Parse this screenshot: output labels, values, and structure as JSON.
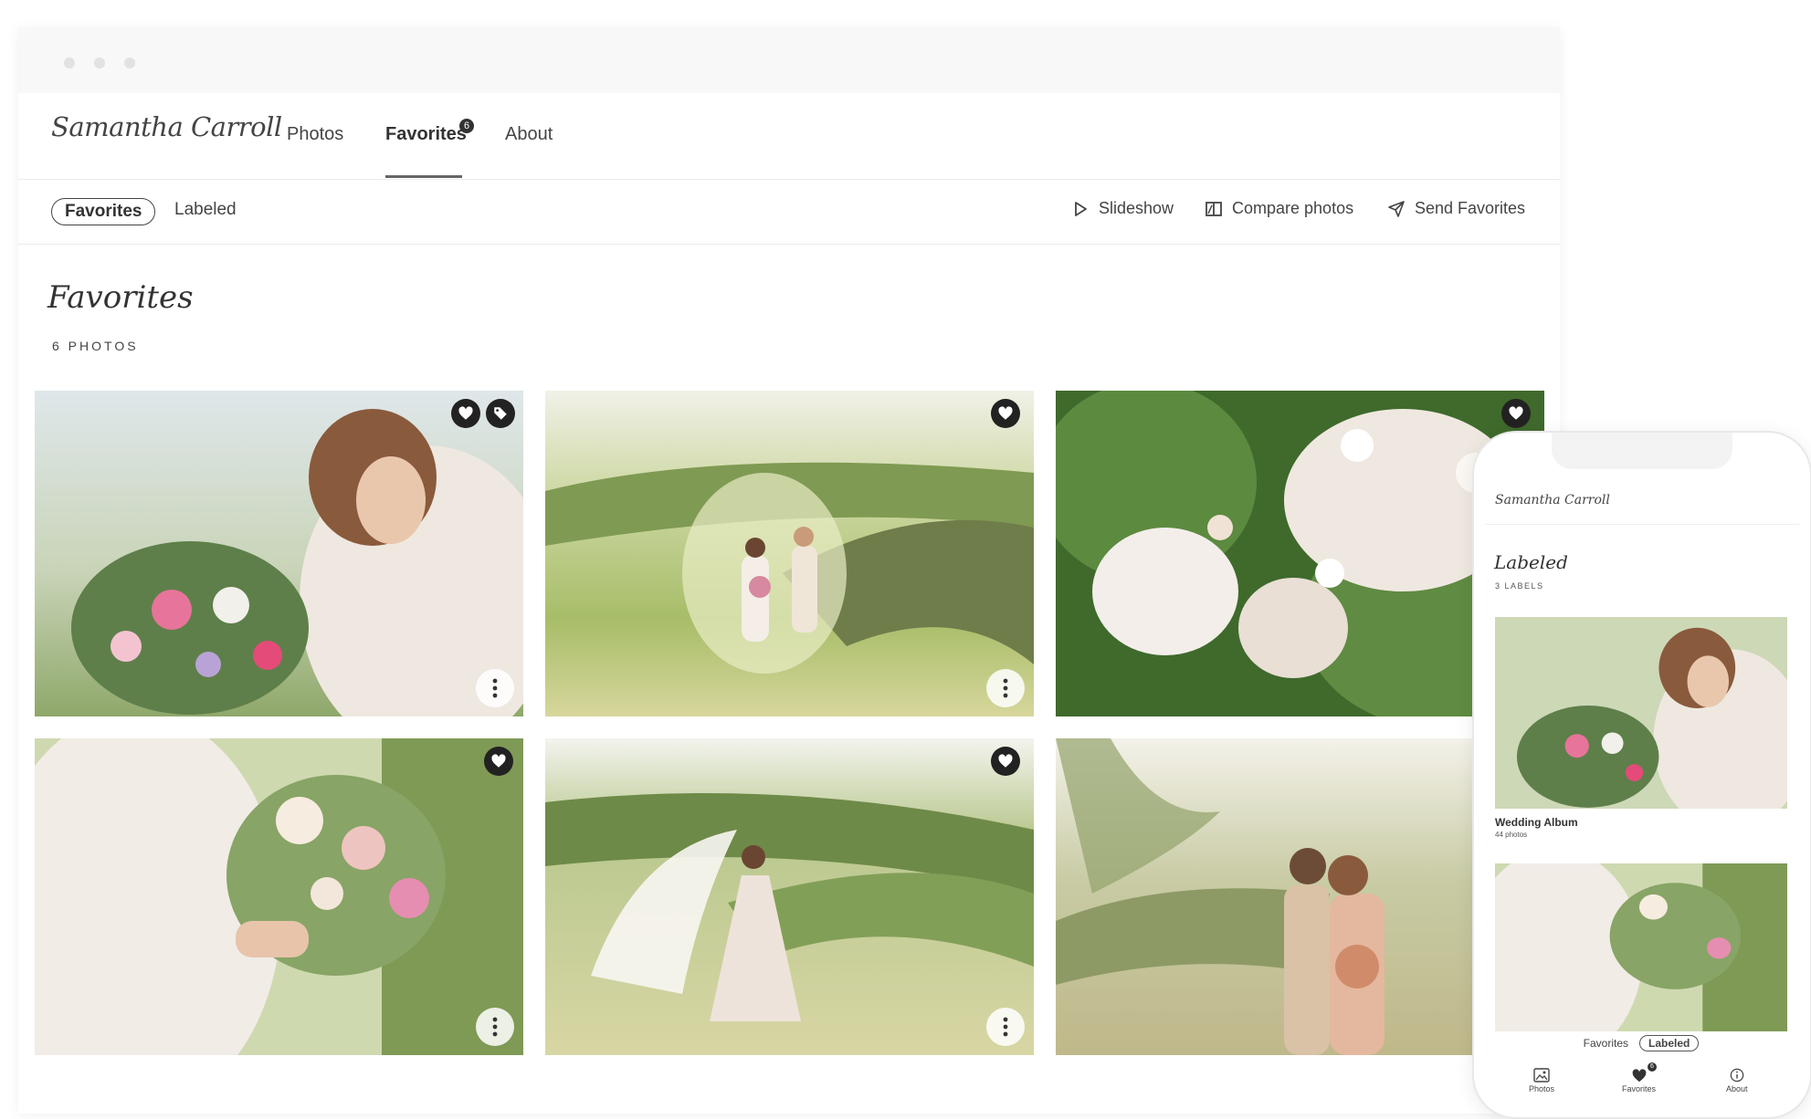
{
  "brand": {
    "signature": "Samantha Carroll"
  },
  "nav": {
    "tabs": [
      {
        "label": "Photos"
      },
      {
        "label": "Favorites",
        "badge": "6"
      },
      {
        "label": "About"
      }
    ]
  },
  "subnav": {
    "filters": [
      {
        "label": "Favorites"
      },
      {
        "label": "Labeled"
      }
    ],
    "actions": [
      {
        "label": "Slideshow",
        "icon": "play-icon"
      },
      {
        "label": "Compare photos",
        "icon": "compare-icon"
      },
      {
        "label": "Send Favorites",
        "icon": "send-icon"
      }
    ]
  },
  "gallery": {
    "title": "Favorites",
    "count_label": "6 PHOTOS",
    "photos": [
      {
        "subject": "bride-with-bouquet",
        "favorited": true,
        "labeled": true
      },
      {
        "subject": "couple-in-hills",
        "favorited": true
      },
      {
        "subject": "white-blossoms",
        "favorited": true
      },
      {
        "subject": "bouquet-closeup",
        "favorited": true
      },
      {
        "subject": "bride-with-veil",
        "favorited": true
      },
      {
        "subject": "couple-kissing",
        "favorited": false
      }
    ]
  },
  "mobile": {
    "signature": "Samantha Carroll",
    "title": "Labeled",
    "count_label": "3 LABELS",
    "album": {
      "name": "Wedding Album",
      "count": "44 photos"
    },
    "filters": [
      {
        "label": "Favorites"
      },
      {
        "label": "Labeled"
      }
    ],
    "bottom_nav": [
      {
        "label": "Photos",
        "icon": "image-icon"
      },
      {
        "label": "Favorites",
        "icon": "heart-icon",
        "badge": "6"
      },
      {
        "label": "About",
        "icon": "info-icon"
      }
    ]
  },
  "colors": {
    "accent": "#222222",
    "border": "#ececec",
    "titlebar": "#f7f8f7"
  }
}
